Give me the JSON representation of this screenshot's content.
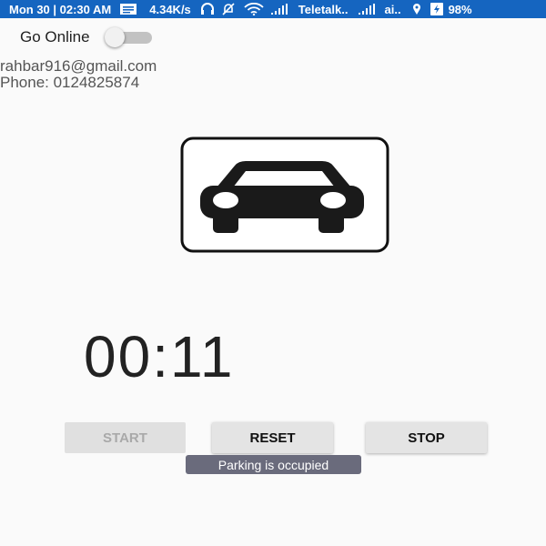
{
  "status_bar": {
    "time": "Mon 30 | 02:30 AM",
    "net_speed": "4.34K/s",
    "carrier1": "Teletalk..",
    "carrier2": "ai..",
    "battery": "98%",
    "icons": [
      "message-icon",
      "headphones-icon",
      "mute-icon",
      "wifi-icon",
      "signal-icon",
      "location-icon",
      "battery-icon"
    ]
  },
  "toggle": {
    "label": "Go Online",
    "on": false
  },
  "profile": {
    "email": "rahbar916@gmail.com",
    "phone": "Phone: 0124825874"
  },
  "timer": {
    "value": "00:11"
  },
  "buttons": {
    "start": "START",
    "reset": "RESET",
    "stop": "STOP"
  },
  "toast": {
    "message": "Parking is occupied"
  },
  "colors": {
    "status_bar": "#1565c0",
    "background": "#fafafa",
    "toast": "#6a6b7c"
  }
}
